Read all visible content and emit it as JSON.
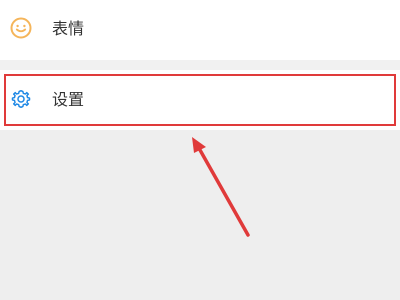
{
  "menu": {
    "items": [
      {
        "label": "表情",
        "icon": "smiley-face-icon",
        "icon_color": "#f5b55a"
      },
      {
        "label": "设置",
        "icon": "gear-icon",
        "icon_color": "#1e88e5"
      }
    ]
  },
  "annotation": {
    "color": "#e03a3a",
    "target": "settings"
  }
}
